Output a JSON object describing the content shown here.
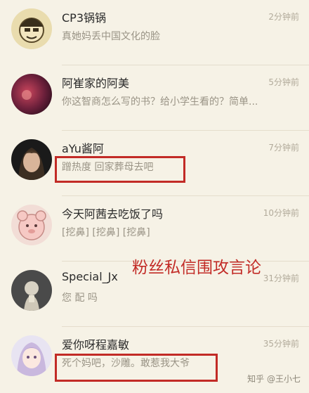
{
  "messages": [
    {
      "name": "CP3锅锅",
      "time": "2分钟前",
      "preview": "真她妈丢中国文化的脸"
    },
    {
      "name": "阿崔家的阿美",
      "time": "5分钟前",
      "preview": "你这智商怎么写的书？给小学生看的？简单..."
    },
    {
      "name": "aYu酱阿",
      "time": "7分钟前",
      "preview": "蹭热度 回家葬母去吧"
    },
    {
      "name": "今天阿茜去吃饭了吗",
      "time": "10分钟前",
      "preview": "[挖鼻] [挖鼻] [挖鼻]"
    },
    {
      "name": "Special_Jx",
      "time": "31分钟前",
      "preview": "您 配 吗"
    },
    {
      "name": "爱你呀程嘉敏",
      "time": "35分钟前",
      "preview": "死个妈吧，沙雕。敢惹我大爷"
    }
  ],
  "annotation": "粉丝私信围攻言论",
  "watermark": "知乎 @王小七",
  "colors": {
    "background": "#f6f2e6",
    "highlight": "#c22b26"
  }
}
